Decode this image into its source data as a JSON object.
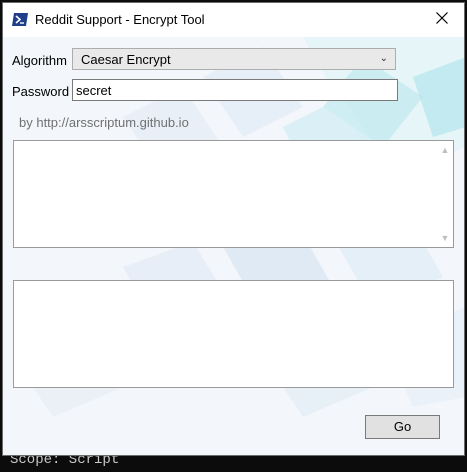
{
  "console": {
    "text": "Scope: Script"
  },
  "window": {
    "title": "Reddit Support - Encrypt Tool",
    "icon": "powershell-icon",
    "close_icon": "close-icon"
  },
  "form": {
    "algorithm_label": "Algorithm",
    "algorithm_value": "Caesar Encrypt",
    "password_label": "Password",
    "password_value": "secret",
    "credit": "by http://arsscriptum.github.io",
    "input_text": "",
    "output_text": "",
    "go_label": "Go"
  },
  "colors": {
    "background_accent": "#7fd8e4",
    "button_face": "#e1e1e1"
  }
}
